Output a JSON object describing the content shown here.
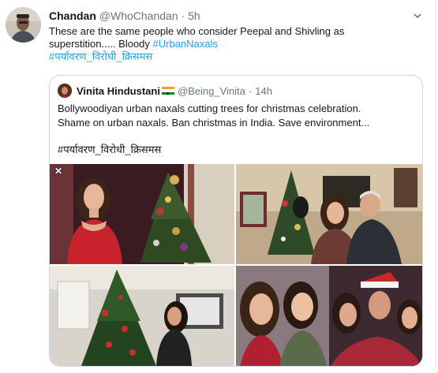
{
  "tweet": {
    "display_name": "Chandan",
    "handle": "@WhoChandan",
    "separator": "·",
    "time": "5h",
    "text_line1": "These are the same people who consider Peepal and Shivling as",
    "text_line2_prefix": "superstition..... Bloody ",
    "hashtag1": "#UrbanNaxals",
    "hashtag2": "#पर्यावरण_विरोधी_क्रिसमस"
  },
  "quoted": {
    "display_name": "Vinita Hindustani",
    "handle": "@Being_Vinita",
    "separator": "·",
    "time": "14h",
    "text_line1": "Bollywoodiyan urban naxals cutting trees for christmas celebration.",
    "text_line2": "Shame on urban naxals. Ban christmas in India. Save environment...",
    "hashtag": "#पर्यावरण_विरोधी_क्रिसमस",
    "close_glyph": "✕"
  },
  "icons": {
    "caret": "chevron-down-icon",
    "flag": "india-flag-icon"
  },
  "colors": {
    "link": "#1da1f2",
    "secondary_text": "#657786",
    "border": "#ccd6dd"
  }
}
